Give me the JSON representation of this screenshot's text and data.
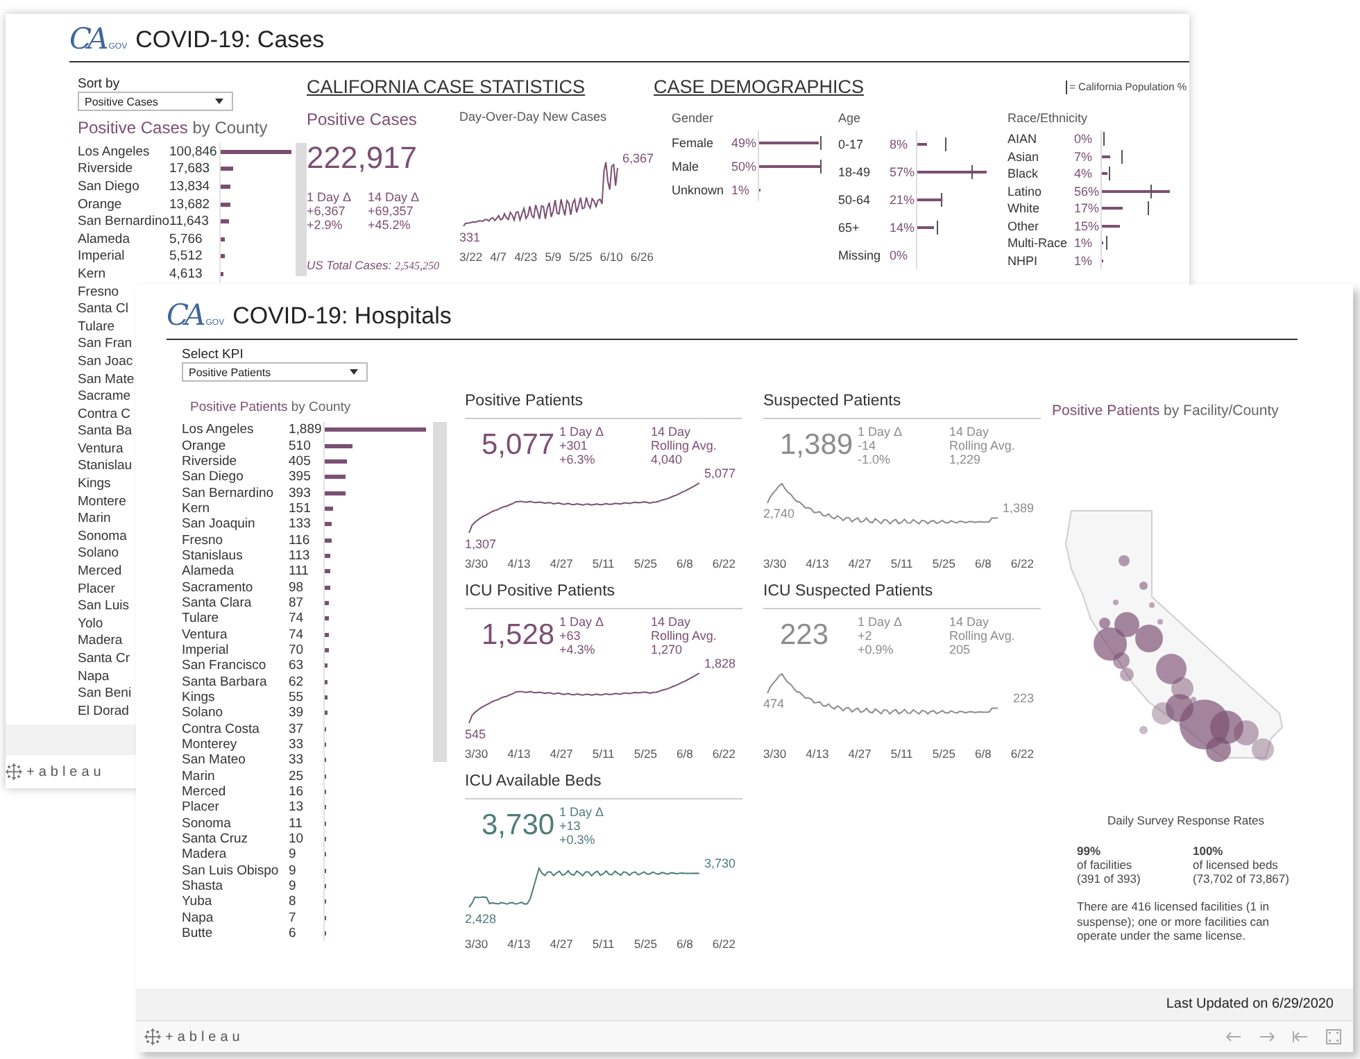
{
  "cases_window": {
    "logo": {
      "mark": "CA",
      "sub": "GOV"
    },
    "title": "COVID-19: Cases",
    "sort": {
      "label": "Sort by",
      "value": "Positive Cases"
    },
    "county_list": {
      "title_highlight": "Positive Cases",
      "title_rest": " by County",
      "rows": [
        {
          "name": "Los Angeles",
          "value": "100,846",
          "level": 1
        },
        {
          "name": "Riverside",
          "value": "17,683",
          "level": 0.175
        },
        {
          "name": "San Diego",
          "value": "13,834",
          "level": 0.137
        },
        {
          "name": "Orange",
          "value": "13,682",
          "level": 0.136
        },
        {
          "name": "San Bernardino",
          "value": "11,643",
          "level": 0.115
        },
        {
          "name": "Alameda",
          "value": "5,766",
          "level": 0.057
        },
        {
          "name": "Imperial",
          "value": "5,512",
          "level": 0.055
        },
        {
          "name": "Kern",
          "value": "4,613",
          "level": 0.046
        },
        {
          "name": "Fresno"
        },
        {
          "name": "Santa Cl"
        },
        {
          "name": "Tulare"
        },
        {
          "name": "San Fran"
        },
        {
          "name": "San Joac"
        },
        {
          "name": "San Mate"
        },
        {
          "name": "Sacrame"
        },
        {
          "name": "Contra C"
        },
        {
          "name": "Santa Ba"
        },
        {
          "name": "Ventura"
        },
        {
          "name": "Stanislau"
        },
        {
          "name": "Kings"
        },
        {
          "name": "Montere"
        },
        {
          "name": "Marin"
        },
        {
          "name": "Sonoma"
        },
        {
          "name": "Solano"
        },
        {
          "name": "Merced"
        },
        {
          "name": "Placer"
        },
        {
          "name": "San Luis"
        },
        {
          "name": "Yolo"
        },
        {
          "name": "Madera"
        },
        {
          "name": "Santa Cr"
        },
        {
          "name": "Napa"
        },
        {
          "name": "San Beni"
        },
        {
          "name": "El Dorad"
        }
      ]
    },
    "statistics": {
      "heading": "CALIFORNIA CASE STATISTICS",
      "title": "Positive Cases",
      "total": "222,917",
      "deltas": [
        [
          "1 Day Δ",
          "+6,367",
          "+2.9%"
        ],
        [
          "14 Day Δ",
          "+69,357",
          "+45.2%"
        ]
      ],
      "us_total_label": "US Total Cases: ",
      "us_total_value": "2,545,250",
      "trend": {
        "title": "Day-Over-Day New Cases",
        "kind": "noisy_rise",
        "start_label": "331",
        "end_label": "6,367",
        "x_labels": [
          "3/22",
          "4/7",
          "4/23",
          "5/9",
          "5/25",
          "6/10",
          "6/26"
        ]
      }
    },
    "demographics": {
      "heading": "CASE DEMOGRAPHICS",
      "legend": "= California Population %",
      "groups": [
        {
          "title": "Gender",
          "rows": [
            {
              "label": "Female",
              "percent": "49%",
              "bar": {
                "level": 0.49
              },
              "population": {
                "level": 0.5
              }
            },
            {
              "label": "Male",
              "percent": "50%",
              "bar": {
                "level": 0.5
              },
              "population": {
                "level": 0.5
              }
            },
            {
              "label": "Unknown",
              "percent": "1%",
              "bar": {
                "level": 0.01
              }
            }
          ]
        },
        {
          "title": "Age",
          "rows": [
            {
              "label": "0-17",
              "percent": "8%",
              "bar": {
                "level": 0.08
              },
              "population": {
                "level": 0.23
              }
            },
            {
              "label": "18-49",
              "percent": "57%",
              "bar": {
                "level": 0.57
              },
              "population": {
                "level": 0.44
              }
            },
            {
              "label": "50-64",
              "percent": "21%",
              "bar": {
                "level": 0.21
              },
              "population": {
                "level": 0.19
              }
            },
            {
              "label": "65+",
              "percent": "14%",
              "bar": {
                "level": 0.14
              },
              "population": {
                "level": 0.16
              }
            },
            {
              "label": "Missing",
              "percent": "0%"
            }
          ]
        },
        {
          "title": "Race/Ethnicity",
          "rows": [
            {
              "label": "AIAN",
              "percent": "0%",
              "population": {
                "level": 0.01
              }
            },
            {
              "label": "Asian",
              "percent": "7%",
              "bar": {
                "level": 0.07
              },
              "population": {
                "level": 0.16
              }
            },
            {
              "label": "Black",
              "percent": "4%",
              "bar": {
                "level": 0.04
              },
              "population": {
                "level": 0.06
              }
            },
            {
              "label": "Latino",
              "percent": "56%",
              "bar": {
                "level": 0.56
              },
              "population": {
                "level": 0.4
              }
            },
            {
              "label": "White",
              "percent": "17%",
              "bar": {
                "level": 0.17
              },
              "population": {
                "level": 0.37
              }
            },
            {
              "label": "Other",
              "percent": "15%",
              "bar": {
                "level": 0.15
              }
            },
            {
              "label": "Multi-Race",
              "percent": "1%",
              "bar": {
                "level": 0.01
              },
              "population": {
                "level": 0.03
              }
            },
            {
              "label": "NHPI",
              "percent": "1%",
              "bar": {
                "level": 0.01
              }
            }
          ]
        }
      ]
    },
    "footer": {
      "logo": "+ableau"
    }
  },
  "hospitals_window": {
    "logo": {
      "mark": "CA",
      "sub": "GOV"
    },
    "title": "COVID-19: Hospitals",
    "kpi": {
      "label": "Select KPI",
      "value": "Positive Patients"
    },
    "county_list": {
      "title_highlight": "Positive Patients",
      "title_rest": " by County",
      "rows": [
        {
          "name": "Los Angeles",
          "value": "1,889",
          "level": 1
        },
        {
          "name": "Orange",
          "value": "510",
          "level": 0.27
        },
        {
          "name": "Riverside",
          "value": "405",
          "level": 0.214
        },
        {
          "name": "San Diego",
          "value": "395",
          "level": 0.209
        },
        {
          "name": "San Bernardino",
          "value": "393",
          "level": 0.208
        },
        {
          "name": "Kern",
          "value": "151",
          "level": 0.08
        },
        {
          "name": "San Joaquin",
          "value": "133",
          "level": 0.07
        },
        {
          "name": "Fresno",
          "value": "116",
          "level": 0.061
        },
        {
          "name": "Stanislaus",
          "value": "113",
          "level": 0.06
        },
        {
          "name": "Alameda",
          "value": "111",
          "level": 0.059
        },
        {
          "name": "Sacramento",
          "value": "98",
          "level": 0.052
        },
        {
          "name": "Santa Clara",
          "value": "87",
          "level": 0.046
        },
        {
          "name": "Tulare",
          "value": "74",
          "level": 0.039
        },
        {
          "name": "Ventura",
          "value": "74",
          "level": 0.039
        },
        {
          "name": "Imperial",
          "value": "70",
          "level": 0.037
        },
        {
          "name": "San Francisco",
          "value": "63",
          "level": 0.033
        },
        {
          "name": "Santa Barbara",
          "value": "62",
          "level": 0.033
        },
        {
          "name": "Kings",
          "value": "55",
          "level": 0.029
        },
        {
          "name": "Solano",
          "value": "39",
          "level": 0.021
        },
        {
          "name": "Contra Costa",
          "value": "37",
          "level": 0.02
        },
        {
          "name": "Monterey",
          "value": "33",
          "level": 0.017
        },
        {
          "name": "San Mateo",
          "value": "33",
          "level": 0.017
        },
        {
          "name": "Marin",
          "value": "25",
          "level": 0.013
        },
        {
          "name": "Merced",
          "value": "16",
          "level": 0.008
        },
        {
          "name": "Placer",
          "value": "13",
          "level": 0.007
        },
        {
          "name": "Sonoma",
          "value": "11",
          "level": 0.006
        },
        {
          "name": "Santa Cruz",
          "value": "10",
          "level": 0.005
        },
        {
          "name": "Madera",
          "value": "9",
          "level": 0.005
        },
        {
          "name": "San Luis Obispo",
          "value": "9",
          "level": 0.005
        },
        {
          "name": "Shasta",
          "value": "9",
          "level": 0.005
        },
        {
          "name": "Yuba",
          "value": "8",
          "level": 0.004
        },
        {
          "name": "Napa",
          "value": "7",
          "level": 0.004
        },
        {
          "name": "Butte",
          "value": "6",
          "level": 0.003
        }
      ]
    },
    "panels": [
      {
        "title": "Positive Patients",
        "color": "#7b4f72",
        "value": "5,077",
        "day_delta": [
          "1 Day Δ",
          "+301",
          "+6.3%"
        ],
        "rolling": [
          "14 Day",
          "Rolling Avg.",
          "4,040"
        ],
        "trend": {
          "kind": "rise_late",
          "start_label": "1,307",
          "end_label": "5,077",
          "x_labels": [
            "3/30",
            "4/13",
            "4/27",
            "5/11",
            "5/25",
            "6/8",
            "6/22"
          ]
        }
      },
      {
        "title": "Suspected Patients",
        "color": "#8c8c8c",
        "value": "1,389",
        "day_delta": [
          "1 Day Δ",
          "-14",
          "-1.0%"
        ],
        "rolling": [
          "14 Day",
          "Rolling Avg.",
          "1,229"
        ],
        "trend": {
          "kind": "peak_decay",
          "start_label": "2,740",
          "end_label": "1,389",
          "x_labels": [
            "3/30",
            "4/13",
            "4/27",
            "5/11",
            "5/25",
            "6/8",
            "6/22"
          ]
        }
      },
      {
        "title": "ICU Positive Patients",
        "color": "#7b4f72",
        "value": "1,528",
        "day_delta": [
          "1 Day Δ",
          "+63",
          "+4.3%"
        ],
        "rolling": [
          "14 Day",
          "Rolling Avg.",
          "1,270"
        ],
        "trend": {
          "kind": "rise_late",
          "start_label": "545",
          "end_label": "1,828",
          "x_labels": [
            "3/30",
            "4/13",
            "4/27",
            "5/11",
            "5/25",
            "6/8",
            "6/22"
          ]
        }
      },
      {
        "title": "ICU Suspected Patients",
        "color": "#8c8c8c",
        "value": "223",
        "day_delta": [
          "1 Day Δ",
          "+2",
          "+0.9%"
        ],
        "rolling": [
          "14 Day",
          "Rolling Avg.",
          "205"
        ],
        "trend": {
          "kind": "peak_decay",
          "start_label": "474",
          "end_label": "223",
          "x_labels": [
            "3/30",
            "4/13",
            "4/27",
            "5/11",
            "5/25",
            "6/8",
            "6/22"
          ]
        }
      },
      {
        "title": "ICU Available Beds",
        "color": "#4e7c79",
        "value": "3,730",
        "day_delta": [
          "1 Day Δ",
          "+13",
          "+0.3%"
        ],
        "trend": {
          "kind": "step_up",
          "start_label": "2,428",
          "end_label": "3,730",
          "x_labels": [
            "3/30",
            "4/13",
            "4/27",
            "5/11",
            "5/25",
            "6/8",
            "6/22"
          ]
        }
      }
    ],
    "map": {
      "title_highlight": "Positive Patients",
      "title_rest": " by Facility/County"
    },
    "survey": {
      "title": "Daily Survey Response Rates",
      "stats": [
        {
          "percent": "99%",
          "lines": [
            "of facilities",
            "(391 of 393)"
          ]
        },
        {
          "percent": "100%",
          "lines": [
            "of licensed beds",
            "(73,702 of 73,867)"
          ]
        }
      ],
      "note": "There are 416 licensed facilities (1 in suspense); one or more facilities can operate under the same license."
    },
    "updated": "Last Updated on 6/29/2020",
    "footer": {
      "logo": "+ableau"
    }
  }
}
